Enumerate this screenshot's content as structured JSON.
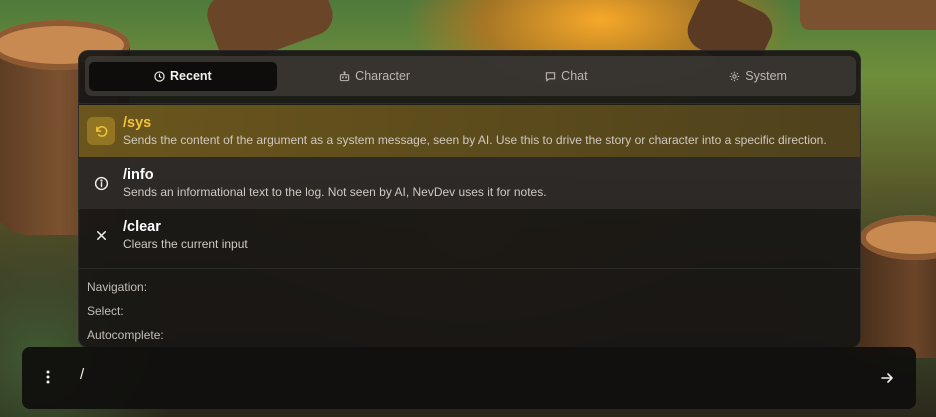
{
  "tabs": [
    {
      "label": "Recent",
      "icon": "clock-icon",
      "active": true
    },
    {
      "label": "Character",
      "icon": "robot-icon",
      "active": false
    },
    {
      "label": "Chat",
      "icon": "chat-bubble-icon",
      "active": false
    },
    {
      "label": "System",
      "icon": "gear-icon",
      "active": false
    }
  ],
  "commands": [
    {
      "name": "/sys",
      "icon": "undo-icon",
      "description": "Sends the content of the argument as a system message, seen by AI. Use this to drive the story or character into a specific direction.",
      "selected": true
    },
    {
      "name": "/info",
      "icon": "info-icon",
      "description": "Sends an informational text to the log. Not seen by AI, NevDev uses it for notes.",
      "selected": false
    },
    {
      "name": "/clear",
      "icon": "close-icon",
      "description": "Clears the current input",
      "selected": false
    }
  ],
  "hints": {
    "navigation": "Navigation:",
    "select": "Select:",
    "autocomplete": "Autocomplete:"
  },
  "input": {
    "value": "/",
    "placeholder": ""
  },
  "colors": {
    "accent": "#f2c23b",
    "selected_row": "#786020",
    "panel": "#181614"
  }
}
